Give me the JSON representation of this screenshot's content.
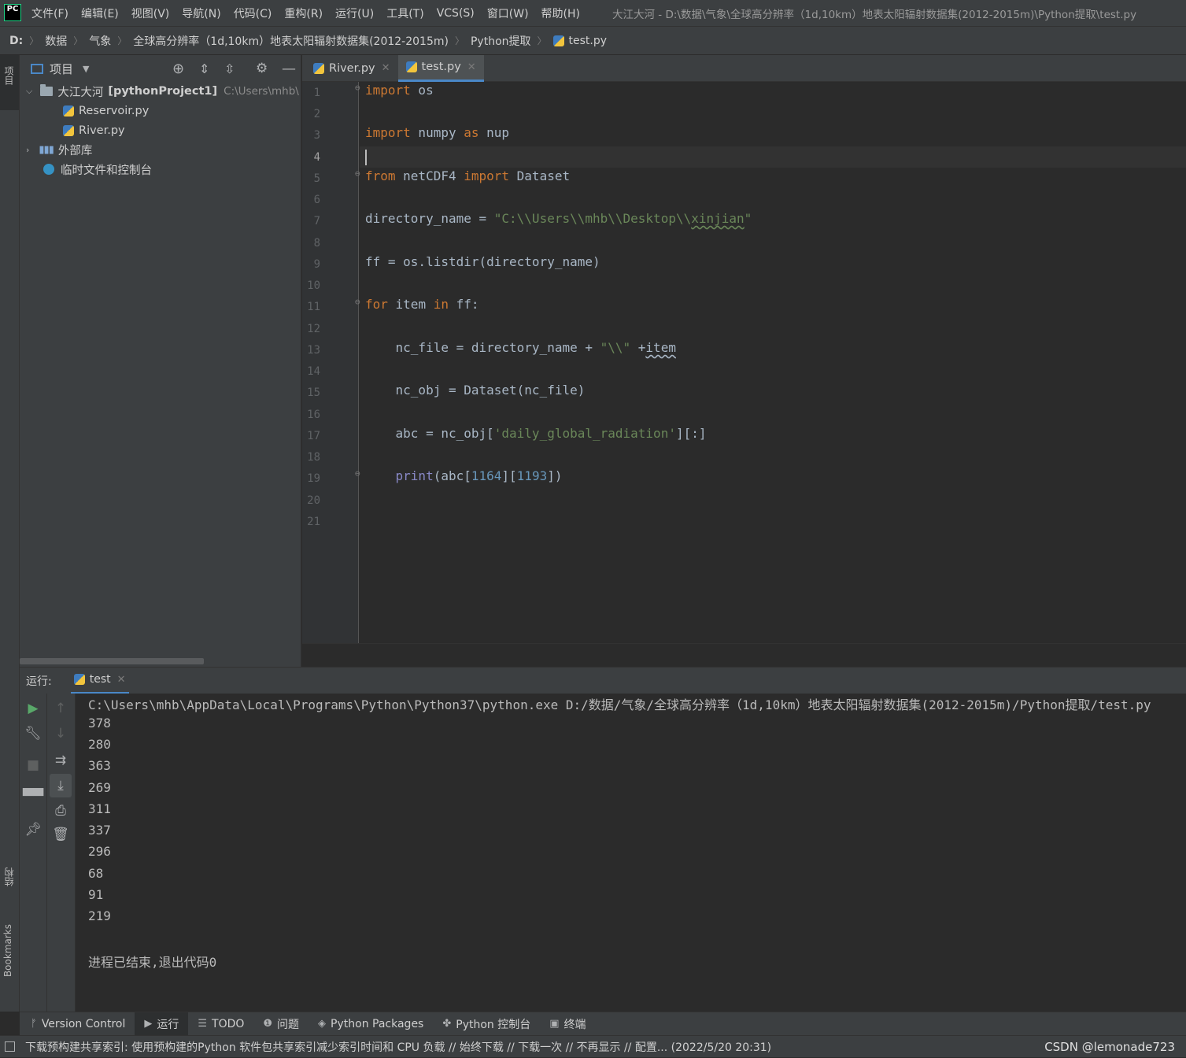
{
  "menubar": {
    "logo": "PC",
    "items": [
      "文件(F)",
      "编辑(E)",
      "视图(V)",
      "导航(N)",
      "代码(C)",
      "重构(R)",
      "运行(U)",
      "工具(T)",
      "VCS(S)",
      "窗口(W)",
      "帮助(H)"
    ],
    "window_title": "大江大河 - D:\\数据\\气象\\全球高分辨率（1d,10km）地表太阳辐射数据集(2012-2015m)\\Python提取\\test.py"
  },
  "breadcrumb": [
    "D:",
    "数据",
    "气象",
    "全球高分辨率（1d,10km）地表太阳辐射数据集(2012-2015m)",
    "Python提取",
    "test.py"
  ],
  "left_strip": {
    "project_tab": "项目",
    "structure_tab": "结构",
    "bookmarks_tab": "Bookmarks"
  },
  "project_panel": {
    "title": "项目",
    "root": {
      "name": "大江大河",
      "module": "[pythonProject1]",
      "path": "C:\\Users\\mhb\\"
    },
    "files": [
      "Reservoir.py",
      "River.py"
    ],
    "external_libs": "外部库",
    "scratches": "临时文件和控制台"
  },
  "editor": {
    "tabs": [
      {
        "label": "River.py",
        "active": false
      },
      {
        "label": "test.py",
        "active": true
      }
    ],
    "line_numbers": [
      "1",
      "2",
      "3",
      "4",
      "5",
      "6",
      "7",
      "8",
      "9",
      "10",
      "11",
      "12",
      "13",
      "14",
      "15",
      "16",
      "17",
      "18",
      "19",
      "20",
      "21"
    ],
    "current_line": "4",
    "code": {
      "l1_kw": "import",
      "l1_rest": " os",
      "l3_kw": "import",
      "l3_mid": " numpy ",
      "l3_kw2": "as",
      "l3_rest": " nup",
      "l5_kw": "from",
      "l5_mid": " netCDF4 ",
      "l5_kw2": "import",
      "l5_rest": " Dataset",
      "l7_a": "directory_name = ",
      "l7_s1": "\"C:\\\\Users\\\\mhb\\\\Desktop\\\\",
      "l7_s2": "xinjian",
      "l7_s3": "\"",
      "l9": "ff = os.listdir(directory_name)",
      "l11_kw": "for",
      "l11_mid": " item ",
      "l11_kw2": "in",
      "l11_rest": " ff:",
      "l13_a": "    nc_file = directory_name + ",
      "l13_s": "\"\\\\\"",
      "l13_b": " +",
      "l13_c": "item",
      "l15": "    nc_obj = Dataset(nc_file)",
      "l17_a": "    abc = nc_obj[",
      "l17_s": "'daily_global_radiation'",
      "l17_b": "][:]",
      "l19_a": "    ",
      "l19_bi": "print",
      "l19_b": "(abc[",
      "l19_n1": "1164",
      "l19_c": "][",
      "l19_n2": "1193",
      "l19_d": "])"
    }
  },
  "run_panel": {
    "label": "运行:",
    "tab": "test",
    "command": "C:\\Users\\mhb\\AppData\\Local\\Programs\\Python\\Python37\\python.exe D:/数据/气象/全球高分辨率（1d,10km）地表太阳辐射数据集(2012-2015m)/Python提取/test.py",
    "output": [
      "378",
      "280",
      "363",
      "269",
      "311",
      "337",
      "296",
      "68",
      "91",
      "219"
    ],
    "exit_message": "进程已结束,退出代码0"
  },
  "tool_tabs": [
    {
      "label": "Version Control",
      "icon": "branch-icon"
    },
    {
      "label": "运行",
      "icon": "play-icon"
    },
    {
      "label": "TODO",
      "icon": "list-icon"
    },
    {
      "label": "问题",
      "icon": "info-icon"
    },
    {
      "label": "Python Packages",
      "icon": "layers-icon"
    },
    {
      "label": "Python 控制台",
      "icon": "python-icon"
    },
    {
      "label": "终端",
      "icon": "terminal-icon"
    }
  ],
  "statusbar": {
    "message": "下载预构建共享索引: 使用预构建的Python 软件包共享索引减少索引时间和 CPU 负载 // 始终下载 // 下载一次 // 不再显示 // 配置... (2022/5/20 20:31)",
    "watermark": "CSDN @lemonade723"
  },
  "colors": {
    "keyword": "#cc7832",
    "string": "#6a8759",
    "number": "#6897bb",
    "builtin": "#8888c6",
    "accent": "#4a88c7"
  }
}
